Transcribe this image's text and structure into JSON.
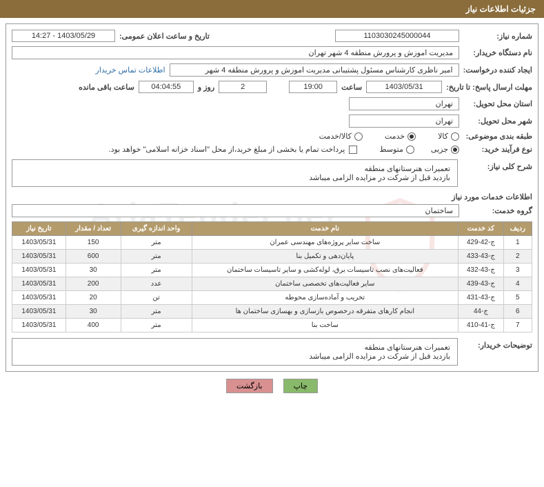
{
  "header": "جزئیات اطلاعات نیاز",
  "labels": {
    "need_no": "شماره نیاز:",
    "announce_date": "تاریخ و ساعت اعلان عمومی:",
    "buyer_org": "نام دستگاه خریدار:",
    "requester": "ایجاد کننده درخواست:",
    "contact_link": "اطلاعات تماس خریدار",
    "deadline": "مهلت ارسال پاسخ: تا تاریخ:",
    "time": "ساعت",
    "days_and": "روز و",
    "remaining": "ساعت باقی مانده",
    "delivery_province": "استان محل تحویل:",
    "delivery_city": "شهر محل تحویل:",
    "subject_class": "طبقه بندی موضوعی:",
    "goods": "کالا",
    "service": "خدمت",
    "goods_service": "کالا/خدمت",
    "purchase_type": "نوع فرآیند خرید:",
    "partial": "جزیی",
    "medium": "متوسط",
    "payment_note": "پرداخت تمام یا بخشی از مبلغ خرید،از محل \"اسناد خزانه اسلامی\" خواهد بود.",
    "need_summary": "شرح کلی نیاز:",
    "service_info": "اطلاعات خدمات مورد نیاز",
    "service_group": "گروه خدمت:",
    "buyer_notes": "توضیحات خریدار:",
    "print": "چاپ",
    "back": "بازگشت"
  },
  "fields": {
    "need_no": "1103030245000044",
    "announce_date": "1403/05/29 - 14:27",
    "buyer_org": "مدیریت اموزش و پرورش منطقه 4 شهر تهران",
    "requester": "امیر ناظری کارشناس مسئول پشتیبانی  مدیریت اموزش و پرورش منطقه 4 شهر",
    "deadline_date": "1403/05/31",
    "deadline_time": "19:00",
    "days": "2",
    "remaining_time": "04:04:55",
    "province": "تهران",
    "city": "تهران",
    "summary_line1": "تعمیرات هنرستانهای منطقه",
    "summary_line2": "بازدید قبل از شرکت در مزایده الزامی میباشد",
    "service_group": "ساختمان",
    "notes_line1": "تعمیرات هنرستانهای منطقه",
    "notes_line2": "بازدید قبل از شرکت در مزایده الزامی میباشد"
  },
  "table": {
    "headers": [
      "ردیف",
      "کد خدمت",
      "نام خدمت",
      "واحد اندازه گیری",
      "تعداد / مقدار",
      "تاریخ نیاز"
    ],
    "rows": [
      {
        "n": "1",
        "code": "ج-42-429",
        "name": "ساخت سایر پروژه‌های مهندسی عمران",
        "unit": "متر",
        "qty": "150",
        "date": "1403/05/31"
      },
      {
        "n": "2",
        "code": "ج-43-433",
        "name": "پایان‌دهی و تکمیل بنا",
        "unit": "متر",
        "qty": "600",
        "date": "1403/05/31"
      },
      {
        "n": "3",
        "code": "ج-43-432",
        "name": "فعالیت‌های نصب تاسیسات برق، لوله‌کشی و سایر تاسیسات ساختمان",
        "unit": "متر",
        "qty": "30",
        "date": "1403/05/31"
      },
      {
        "n": "4",
        "code": "ج-43-439",
        "name": "سایر فعالیت‌های تخصصی ساختمان",
        "unit": "عدد",
        "qty": "200",
        "date": "1403/05/31"
      },
      {
        "n": "5",
        "code": "ج-43-431",
        "name": "تخریب و آماده‌سازی محوطه",
        "unit": "تن",
        "qty": "20",
        "date": "1403/05/31"
      },
      {
        "n": "6",
        "code": "ج-44",
        "name": "انجام کارهای متفرقه درخصوص بازسازی و بهسازی ساختمان ها",
        "unit": "متر",
        "qty": "30",
        "date": "1403/05/31"
      },
      {
        "n": "7",
        "code": "ج-41-410",
        "name": "ساخت بنا",
        "unit": "متر",
        "qty": "400",
        "date": "1403/05/31"
      }
    ]
  },
  "watermark": "AriaTender.net"
}
